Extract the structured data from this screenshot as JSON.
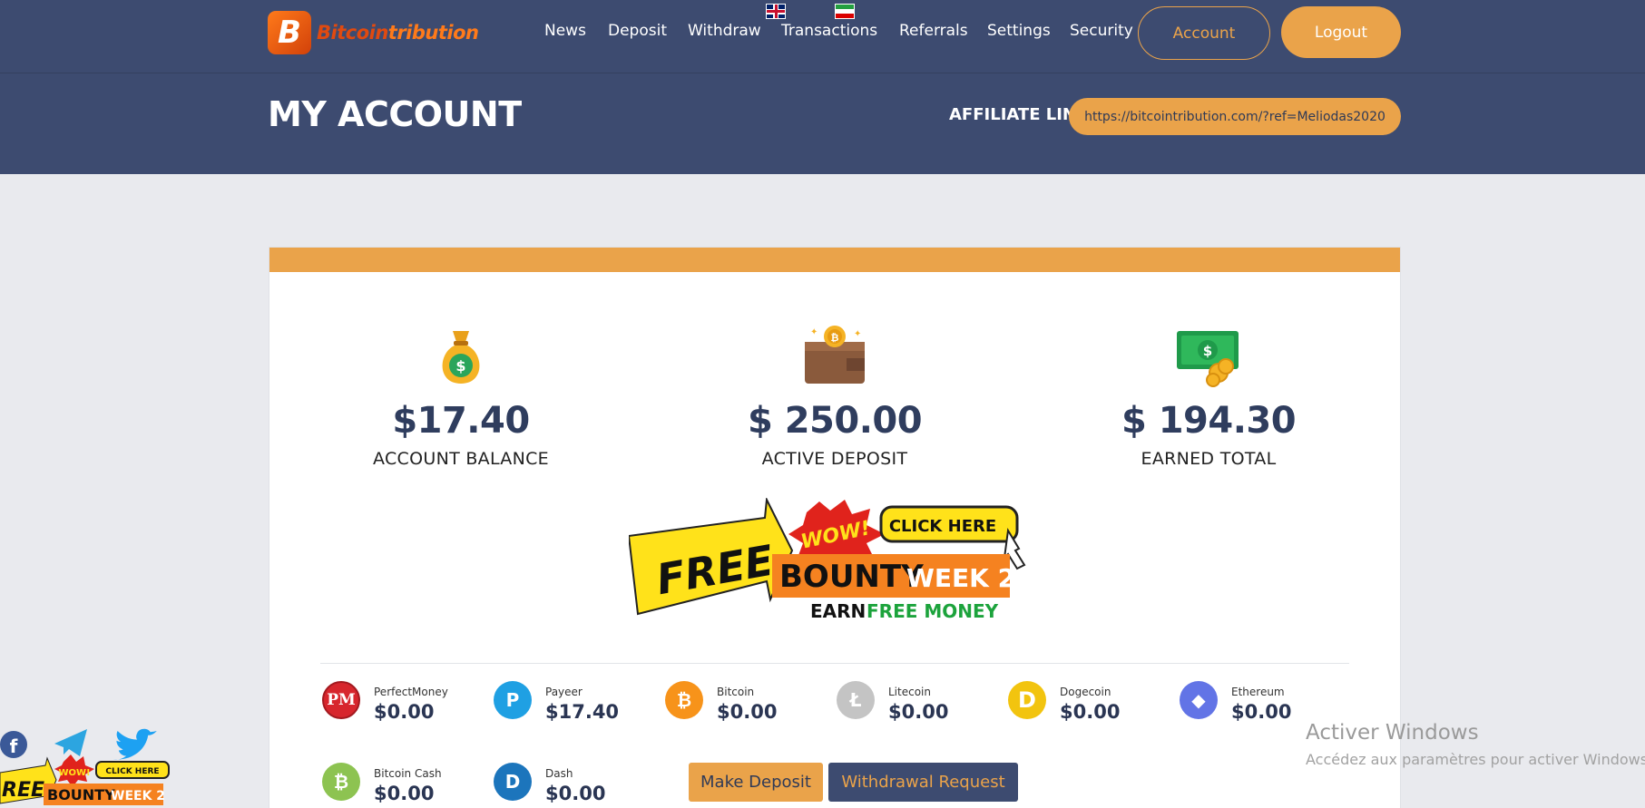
{
  "brand": {
    "mark": "B",
    "name_part1": "Bitcoin",
    "name_part2": "tribution"
  },
  "nav": {
    "items": [
      {
        "label": "News"
      },
      {
        "label": "Deposit"
      },
      {
        "label": "Withdraw"
      },
      {
        "label": "Transactions"
      },
      {
        "label": "Referrals"
      },
      {
        "label": "Settings"
      },
      {
        "label": "Security"
      }
    ],
    "account_label": "Account",
    "logout_label": "Logout",
    "flags": [
      "uk-flag-icon",
      "iran-flag-icon"
    ]
  },
  "page": {
    "title": "MY ACCOUNT",
    "affiliate_label": "AFFILIATE LINK:",
    "affiliate_link": "https://bitcointribution.com/?ref=Meliodas2020"
  },
  "stats": [
    {
      "icon": "money-bag-icon",
      "value": "$17.40",
      "label": "ACCOUNT BALANCE"
    },
    {
      "icon": "wallet-coin-icon",
      "value": "$ 250.00",
      "label": "ACTIVE DEPOSIT"
    },
    {
      "icon": "cash-coins-icon",
      "value": "$ 194.30",
      "label": "EARNED TOTAL"
    }
  ],
  "banner": {
    "free": "FREE",
    "wow": "WOW!",
    "click": "CLICK HERE",
    "bounty": "BOUNTY",
    "week": "WEEK 2",
    "earn": "EARN",
    "free_money": "FREE MONEY"
  },
  "wallets": [
    {
      "name": "PerfectMoney",
      "value": "$0.00",
      "icon_text": "PM",
      "color": "#d7262d"
    },
    {
      "name": "Payeer",
      "value": "$17.40",
      "icon_text": "P",
      "color": "#1fa0e3"
    },
    {
      "name": "Bitcoin",
      "value": "$0.00",
      "icon_text": "₿",
      "color": "#f7931a"
    },
    {
      "name": "Litecoin",
      "value": "$0.00",
      "icon_text": "Ł",
      "color": "#bfbfbf"
    },
    {
      "name": "Dogecoin",
      "value": "$0.00",
      "icon_text": "D",
      "color": "#f2c40f"
    },
    {
      "name": "Ethereum",
      "value": "$0.00",
      "icon_text": "◆",
      "color": "#6274e6"
    },
    {
      "name": "Bitcoin Cash",
      "value": "$0.00",
      "icon_text": "₿",
      "color": "#8dc351"
    },
    {
      "name": "Dash",
      "value": "$0.00",
      "icon_text": "D",
      "color": "#1c75bc"
    }
  ],
  "actions": {
    "deposit": "Make Deposit",
    "withdraw": "Withdrawal Request"
  },
  "social": {
    "mini_banner_free": "REE",
    "mini_click": "CLICK HERE",
    "mini_bounty": "BOUNTY",
    "mini_week": "WEEK 2",
    "mini_wow": "WOW!"
  },
  "watermark": {
    "title": "Activer Windows",
    "subtitle": "Accédez aux paramètres pour activer Windows."
  }
}
